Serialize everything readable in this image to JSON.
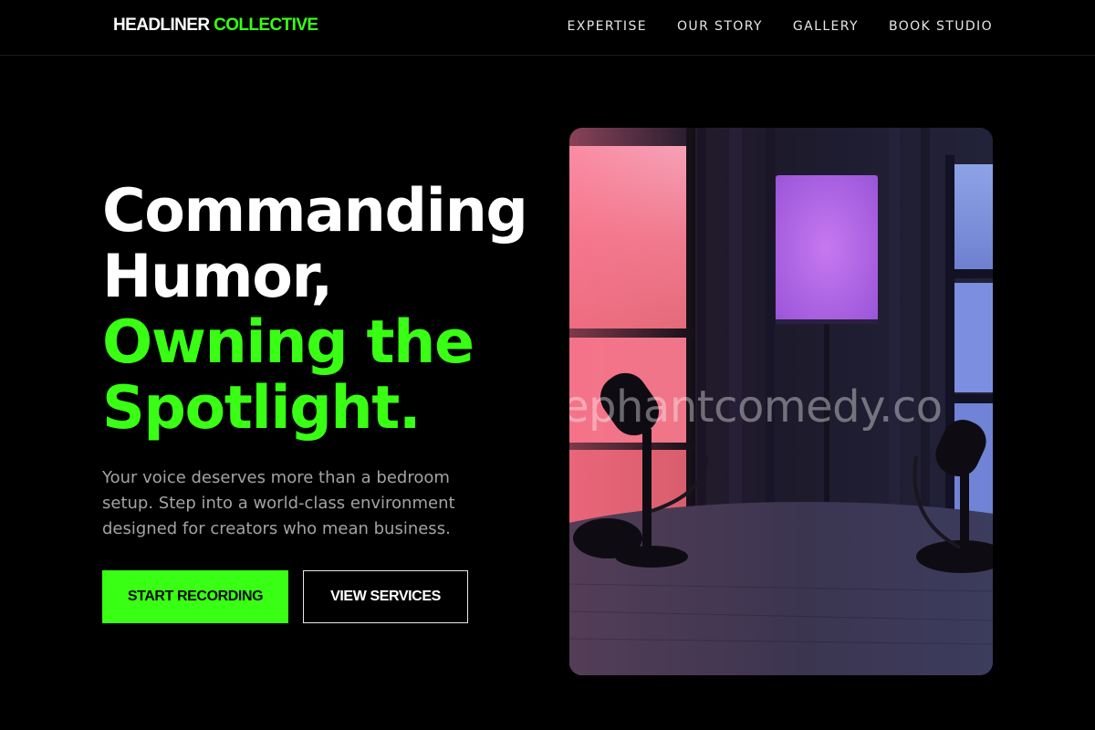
{
  "nav": {
    "logo_part1": "HEADLINER",
    "logo_part2": "COLLECTIVE",
    "links": [
      "EXPERTISE",
      "OUR STORY",
      "GALLERY",
      "BOOK STUDIO"
    ]
  },
  "hero": {
    "headline_white": [
      "Commanding",
      "Humor,"
    ],
    "headline_green": [
      "Owning the",
      "Spotlight."
    ],
    "subtitle": "Your voice deserves more than a bedroom setup. Step into a world-class environment designed for creators who mean business.",
    "primary_button": "START RECORDING",
    "secondary_button": "VIEW SERVICES",
    "image_watermark": "ephantcomedy.co"
  },
  "colors": {
    "accent": "#39ff14",
    "background": "#000000",
    "muted_text": "#a3a3a3"
  }
}
